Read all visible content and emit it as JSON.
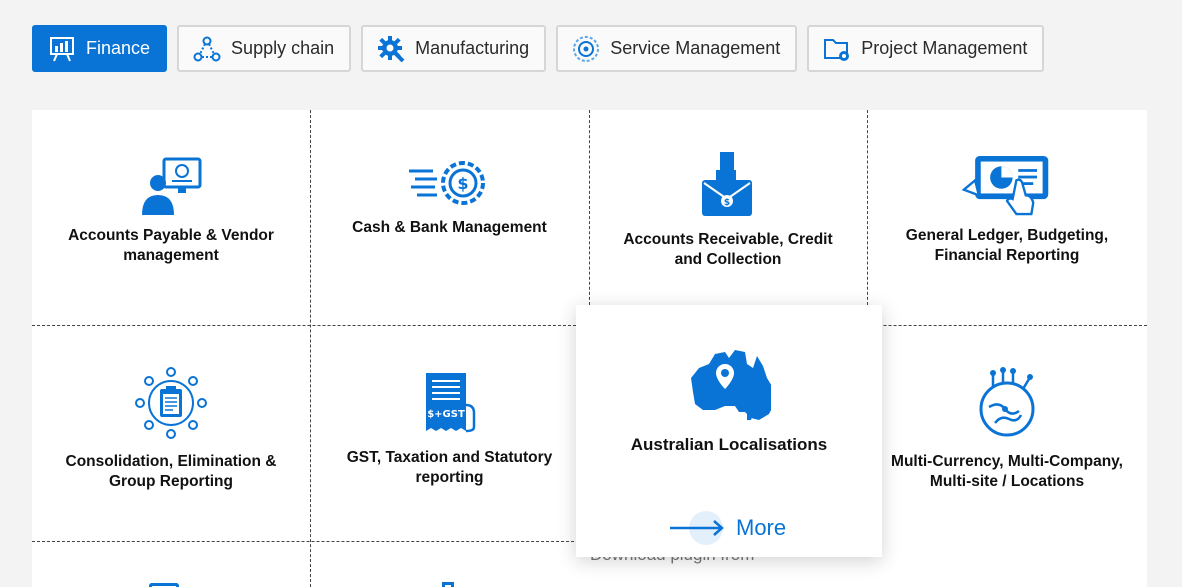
{
  "tabs": [
    {
      "label": "Finance",
      "icon": "chart-board-icon",
      "active": true
    },
    {
      "label": "Supply chain",
      "icon": "network-triangle-icon"
    },
    {
      "label": "Manufacturing",
      "icon": "gear-wrench-icon"
    },
    {
      "label": "Service Management",
      "icon": "service-gear-icon"
    },
    {
      "label": "Project Management",
      "icon": "folder-gear-icon"
    }
  ],
  "modules": [
    {
      "label": "Accounts Payable & Vendor management",
      "icon": "user-computer-icon"
    },
    {
      "label": "Cash & Bank Management",
      "icon": "dollar-gear-icon"
    },
    {
      "label": "Accounts Receivable, Credit and Collection",
      "icon": "hand-envelope-icon"
    },
    {
      "label": "General Ledger, Budgeting, Financial Reporting",
      "icon": "tablet-chart-icon"
    },
    {
      "label": "Consolidation, Elimination & Group Reporting",
      "icon": "clipboard-network-icon"
    },
    {
      "label": "GST, Taxation and Statutory reporting",
      "icon": "gst-receipt-icon"
    },
    {
      "label": "Multi-Currency, Multi-Company, Multi-site / Locations",
      "icon": "circuit-globe-icon"
    }
  ],
  "popup": {
    "title": "Australian Localisations",
    "icon": "australia-map-icon",
    "more_label": "More",
    "behind_text": "Download plugin from"
  },
  "colors": {
    "accent": "#0a74d6",
    "border": "#d6d6d6"
  }
}
